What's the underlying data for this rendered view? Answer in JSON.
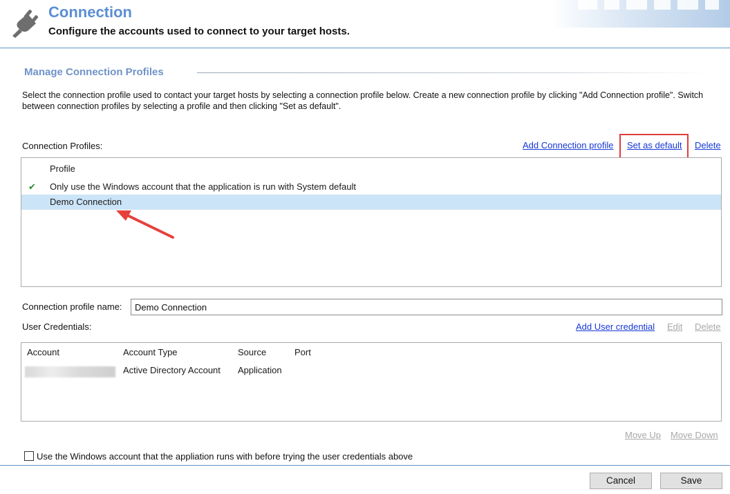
{
  "header": {
    "title": "Connection",
    "subtitle": "Configure the accounts used to connect to your target hosts.",
    "icon": "plug-icon"
  },
  "section": {
    "title": "Manage Connection Profiles",
    "description": "Select the connection profile used to contact your target hosts by selecting a connection profile below. Create a new connection profile by clicking \"Add Connection profile\". Switch between connection profiles by selecting a profile and then clicking \"Set as default\"."
  },
  "profiles": {
    "label": "Connection Profiles:",
    "actions": {
      "add": "Add Connection profile",
      "set_default": "Set as default",
      "delete": "Delete"
    },
    "column_header": "Profile",
    "rows": [
      {
        "name": "Only use the Windows account that the application is run with System default",
        "is_default": true,
        "selected": false
      },
      {
        "name": "Demo Connection",
        "is_default": false,
        "selected": true
      }
    ]
  },
  "profile_name": {
    "label": "Connection profile name:",
    "value": "Demo Connection"
  },
  "credentials": {
    "label": "User Credentials:",
    "actions": {
      "add": "Add User credential",
      "edit": "Edit",
      "delete": "Delete"
    },
    "columns": [
      "Account",
      "Account Type",
      "Source",
      "Port"
    ],
    "rows": [
      {
        "account": "",
        "account_type": "Active Directory Account",
        "source": "Application",
        "port": ""
      }
    ],
    "move_up": "Move Up",
    "move_down": "Move Down"
  },
  "windows_account_checkbox": {
    "label": "Use the Windows account that the appliation runs with before trying the user credentials above",
    "checked": false
  },
  "buttons": {
    "cancel": "Cancel",
    "save": "Save"
  },
  "colors": {
    "title_blue": "#5b8ed3",
    "section_blue": "#6f93c9",
    "link_blue": "#1537d6",
    "selection": "#cce4f7",
    "highlight_red": "#e03c3c",
    "check_green": "#2e8b2e"
  }
}
